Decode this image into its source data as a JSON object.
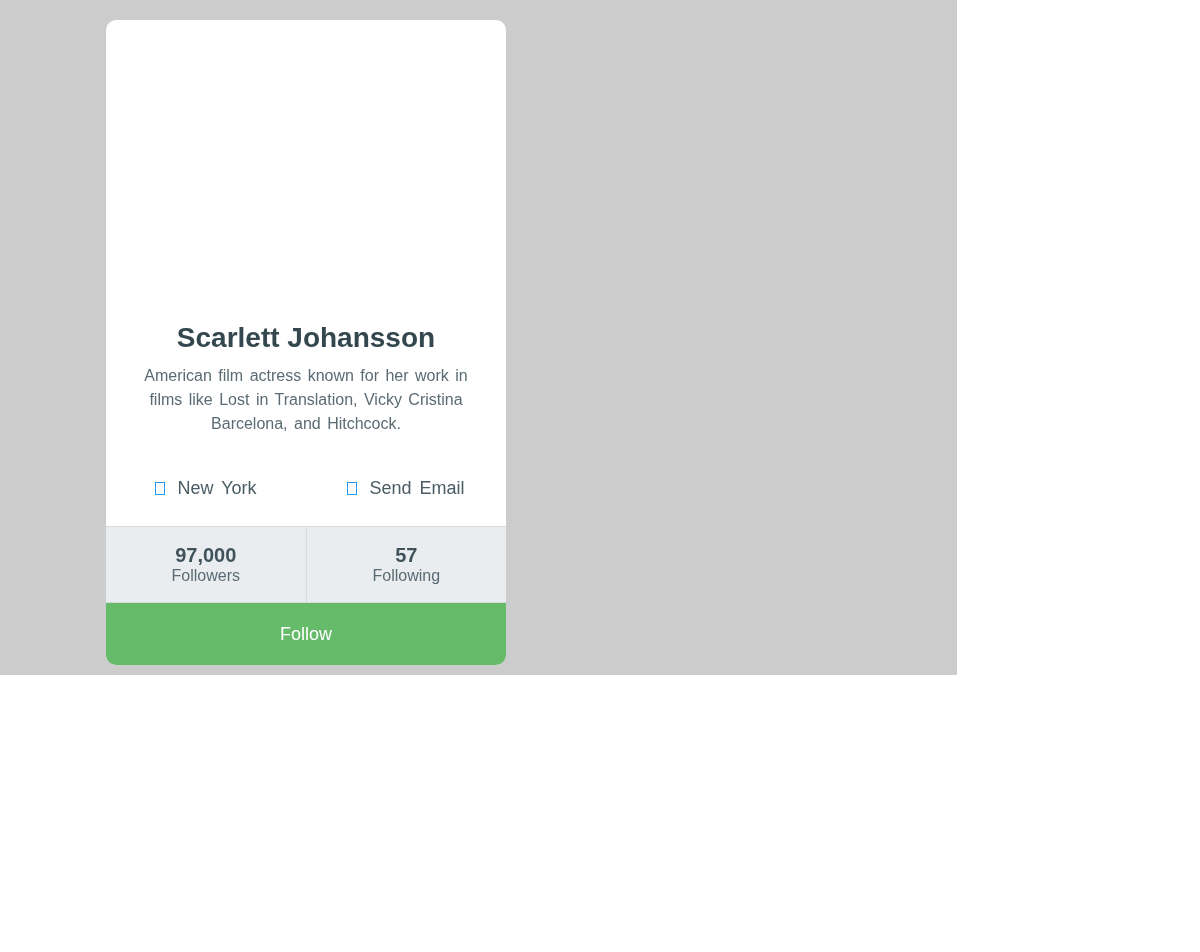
{
  "profile": {
    "name": "Scarlett Johansson",
    "bio": "American film actress known for her work in films like Lost in Translation, Vicky Cristina Barcelona, and Hitchcock.",
    "links": [
      {
        "label": "New York"
      },
      {
        "label": "Send Email"
      }
    ],
    "stats": [
      {
        "value": "97,000",
        "label": "Followers"
      },
      {
        "value": "57",
        "label": "Following"
      }
    ],
    "button": "Follow"
  }
}
